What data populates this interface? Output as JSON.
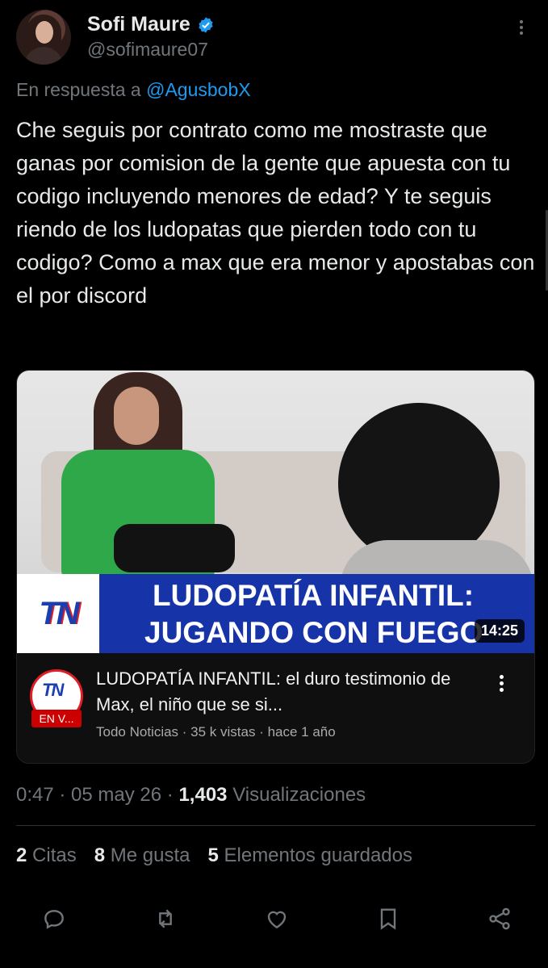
{
  "author": {
    "name": "Sofi Maure",
    "handle": "@sofimaure07",
    "verified": true
  },
  "reply": {
    "prefix": "En respuesta a",
    "mention": "@AgusbobX"
  },
  "tweet": {
    "text": "Che seguis por contrato como me mostraste que ganas por comision de la gente que apuesta con tu codigo incluyendo menores de edad? Y te seguis riendo de los ludopatas que pierden todo con tu codigo? Como a max que era menor y apostabas con el por discord"
  },
  "video_card": {
    "banner_logo": "TN",
    "banner_line1": "LUDOPATÍA INFANTIL:",
    "banner_line2": "JUGANDO CON FUEGO",
    "duration": "14:25",
    "channel_logo": "TN",
    "live_badge": "EN V...",
    "title": "LUDOPATÍA INFANTIL: el duro testimonio de Max, el niño que se si...",
    "meta": "Todo Noticias · 35 k vistas · hace 1 año"
  },
  "meta": {
    "time": "0:47",
    "date": "05 may 26",
    "views_count": "1,403",
    "views_label": "Visualizaciones"
  },
  "stats": {
    "quotes_count": "2",
    "quotes_label": "Citas",
    "likes_count": "8",
    "likes_label": "Me gusta",
    "bookmarks_count": "5",
    "bookmarks_label": "Elementos guardados"
  },
  "actions": [
    "reply-icon",
    "retweet-icon",
    "like-icon",
    "bookmark-icon",
    "share-icon"
  ],
  "colors": {
    "background": "#000000",
    "text": "#e7e9ea",
    "secondary": "#71767b",
    "accent": "#1d9bf0"
  }
}
